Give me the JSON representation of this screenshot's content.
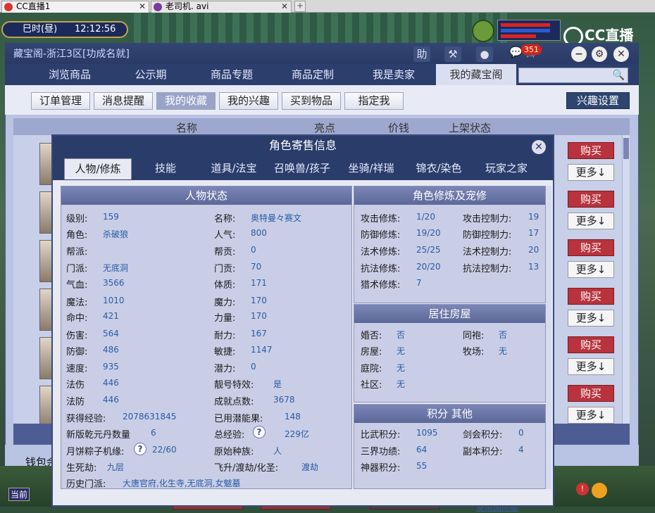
{
  "browser": {
    "tabs": [
      {
        "label": "CC直播1"
      },
      {
        "label": "老司机. avi"
      }
    ],
    "new_tab": "+"
  },
  "game": {
    "time_label": "巳时(昼)",
    "time": "12:12:56",
    "logo_text": "CC直播",
    "current_label": "当前"
  },
  "window": {
    "title": "藏宝阁-浙江3区[功成名就]",
    "help_icon": "助",
    "msg_count": "351",
    "nav_tabs": [
      "浏览商品",
      "公示期",
      "商品专题",
      "商品定制",
      "我是卖家",
      "我的藏宝阁"
    ],
    "sub_buttons": [
      "订单管理",
      "消息提醒",
      "我的收藏",
      "我的兴趣",
      "买到物品",
      "指定我"
    ],
    "interest_settings": "兴趣设置",
    "list_headers": [
      "名称",
      "亮点",
      "价钱",
      "上架状态"
    ],
    "row_actions": {
      "buy": "购买",
      "more": "更多↓"
    },
    "wallet_label": "钱包余",
    "foot_link": "使用国际版"
  },
  "dialog": {
    "title": "角色寄售信息",
    "tabs": [
      "人物/修炼",
      "技能",
      "道具/法宝",
      "召唤兽/孩子",
      "坐骑/祥瑞",
      "锦衣/染色",
      "玩家之家"
    ],
    "status": {
      "header": "人物状态",
      "left_col": [
        {
          "label": "级别:",
          "value": "159"
        },
        {
          "label": "角色:",
          "value": "杀破狼"
        },
        {
          "label": "帮派:",
          "value": ""
        },
        {
          "label": "门派:",
          "value": "无底洞"
        },
        {
          "label": "气血:",
          "value": "3566"
        },
        {
          "label": "魔法:",
          "value": "1010"
        },
        {
          "label": "命中:",
          "value": "421"
        },
        {
          "label": "伤害:",
          "value": "564"
        },
        {
          "label": "防御:",
          "value": "486"
        },
        {
          "label": "速度:",
          "value": "935"
        },
        {
          "label": "法伤",
          "value": "446"
        },
        {
          "label": "法防",
          "value": "446"
        }
      ],
      "right_col": [
        {
          "label": "名称:",
          "value": "奥特曼々赛文"
        },
        {
          "label": "人气:",
          "value": "800"
        },
        {
          "label": "帮贡:",
          "value": "0"
        },
        {
          "label": "门贡:",
          "value": "70"
        },
        {
          "label": "体质:",
          "value": "171"
        },
        {
          "label": "魔力:",
          "value": "170"
        },
        {
          "label": "力量:",
          "value": "170"
        },
        {
          "label": "耐力:",
          "value": "167"
        },
        {
          "label": "敏捷:",
          "value": "1147"
        },
        {
          "label": "潜力:",
          "value": "0"
        },
        {
          "label": "靓号特效:",
          "value": "是"
        },
        {
          "label": "成就点数:",
          "value": "3678"
        }
      ],
      "exp_label": "获得经验:",
      "exp_value": "2078631845",
      "potential_fruit_label": "已用潜能果:",
      "potential_fruit_value": "148",
      "qianyuan_label": "新版乾元丹数量",
      "qianyuan_value": "6",
      "total_exp_label": "总经验:",
      "total_exp_value": "229亿",
      "mooncake_label": "月饼粽子机缘:",
      "mooncake_value": "22/60",
      "race_label": "原始种族:",
      "race_value": "人",
      "life_label": "生死劫:",
      "life_value": "九层",
      "fly_label": "飞升/渡劫/化圣:",
      "fly_value": "渡劫",
      "history_label": "历史门派:",
      "history_value": "大唐官府,化生寺,无底洞,女魃墓"
    },
    "cultivation": {
      "header": "角色修炼及宠修",
      "left": [
        {
          "label": "攻击修炼:",
          "value": "1/20"
        },
        {
          "label": "防御修炼:",
          "value": "19/20"
        },
        {
          "label": "法术修炼:",
          "value": "25/25"
        },
        {
          "label": "抗法修炼:",
          "value": "20/20"
        },
        {
          "label": "猎术修炼:",
          "value": "7"
        }
      ],
      "right": [
        {
          "label": "攻击控制力:",
          "value": "19"
        },
        {
          "label": "防御控制力:",
          "value": "17"
        },
        {
          "label": "法术控制力:",
          "value": "20"
        },
        {
          "label": "抗法控制力:",
          "value": "13"
        }
      ]
    },
    "housing": {
      "header": "居住房屋",
      "items": [
        {
          "label": "婚否:",
          "value": "否"
        },
        {
          "label": "同袍:",
          "value": "否"
        },
        {
          "label": "房屋:",
          "value": "无"
        },
        {
          "label": "牧场:",
          "value": "无"
        },
        {
          "label": "庭院:",
          "value": "无"
        },
        {
          "label": "社区:",
          "value": "无"
        }
      ]
    },
    "points": {
      "header": "积分 其他",
      "items": [
        {
          "label": "比武积分:",
          "value": "1095"
        },
        {
          "label": "剑会积分:",
          "value": "0"
        },
        {
          "label": "三界功绩:",
          "value": "64"
        },
        {
          "label": "副本积分:",
          "value": "4"
        },
        {
          "label": "神器积分:",
          "value": "55"
        }
      ]
    }
  }
}
